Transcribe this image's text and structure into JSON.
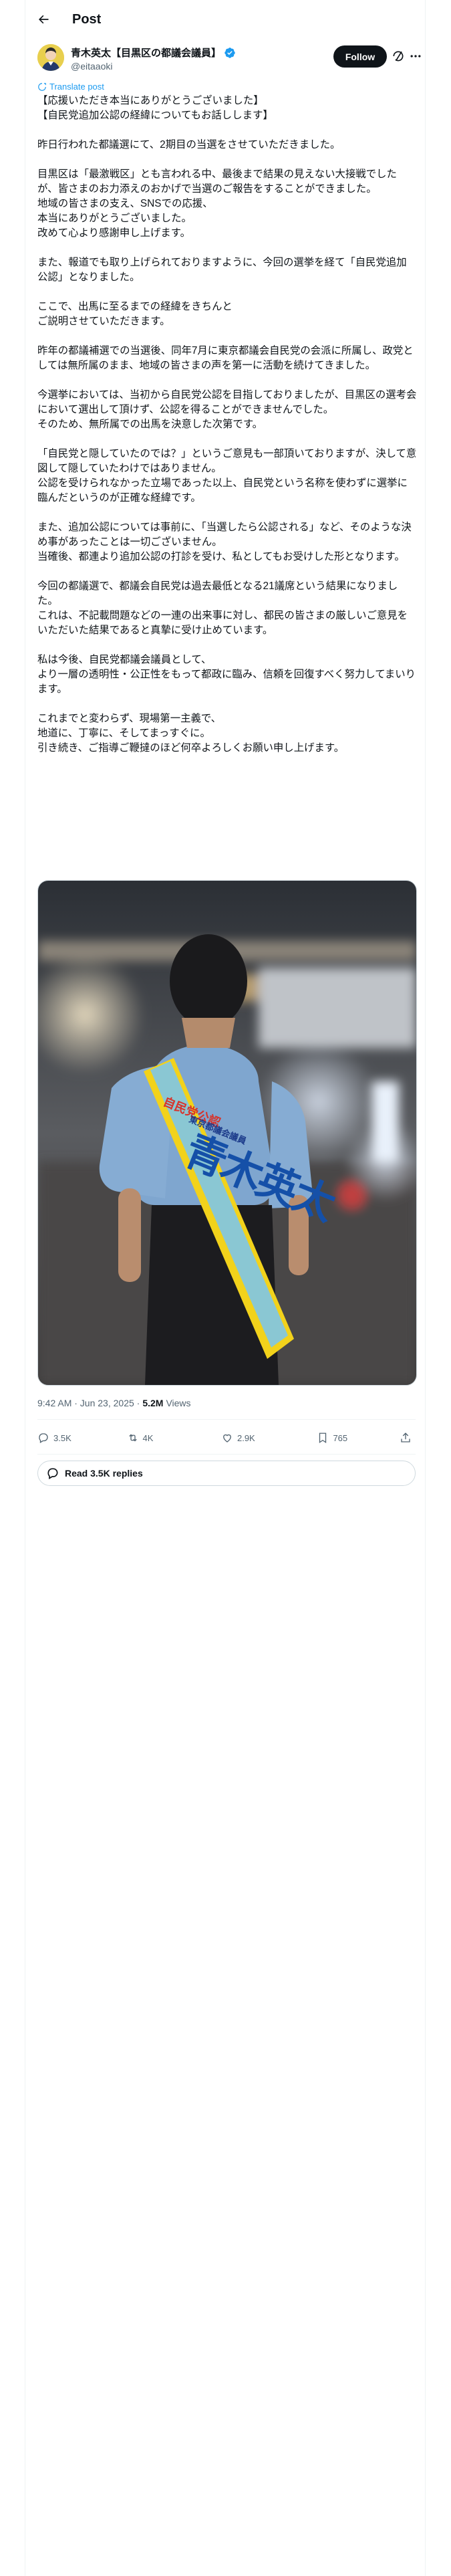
{
  "header": {
    "back_label": "←",
    "title": "Post"
  },
  "author": {
    "name": "青木英太【目黒区の都議会議員】",
    "handle": "@eitaaoki",
    "follow_label": "Follow"
  },
  "translate_label": "Translate post",
  "post_paragraphs": [
    [
      "【応援いただき本当にありがとうございました】",
      "【自民党追加公認の経緯についてもお話しします】"
    ],
    [
      "昨日行われた都議選にて、2期目の当選をさせていただきました。"
    ],
    [
      "目黒区は「最激戦区」とも言われる中、最後まで結果の見えない大接戦でしたが、皆さまのお力添えのおかげで当選のご報告をすることができました。",
      "地域の皆さまの支え、SNSでの応援、",
      "本当にありがとうございました。",
      "改めて心より感謝申し上げます。"
    ],
    [
      "また、報道でも取り上げられておりますように、今回の選挙を経て「自民党追加公認」となりました。"
    ],
    [
      "ここで、出馬に至るまでの経緯をきちんと",
      "ご説明させていただきます。"
    ],
    [
      "昨年の都議補選での当選後、同年7月に東京都議会自民党の会派に所属し、政党としては無所属のまま、地域の皆さまの声を第一に活動を続けてきました。"
    ],
    [
      "今選挙においては、当初から自民党公認を目指しておりましたが、目黒区の選考会において選出して頂けず、公認を得ることができませんでした。",
      "そのため、無所属での出馬を決意した次第です。"
    ],
    [
      "「自民党と隠していたのでは？」というご意見も一部頂いておりますが、決して意図して隠していたわけではありません。",
      "公認を受けられなかった立場であった以上、自民党という名称を使わずに選挙に臨んだというのが正確な経緯です。"
    ],
    [
      "また、追加公認については事前に、「当選したら公認される」など、そのような決め事があったことは一切ございません。",
      "当確後、都連より追加公認の打診を受け、私としてもお受けした形となります。"
    ],
    [
      "今回の都議選で、都議会自民党は過去最低となる21議席という結果になりました。",
      "これは、不記載問題などの一連の出来事に対し、都民の皆さまの厳しいご意見をいただいた結果であると真摯に受け止めています。"
    ],
    [
      "私は今後、自民党都議会議員として、",
      "より一層の透明性・公正性をもって都政に臨み、信頼を回復すべく努力してまいります。"
    ],
    [
      "これまでと変わらず、現場第一主義で、",
      "地道に、丁寧に、そしてまっすぐに。",
      "引き続き、ご指導ご鞭撻のほど何卒よろしくお願い申し上げます。"
    ]
  ],
  "photo": {
    "sash_line1": "自民党公認",
    "sash_line2": "東京都議会議員",
    "sash_name": "青木英太"
  },
  "meta": {
    "time": "9:42 AM · Jun 23, 2025 ·",
    "views_count": "5.2M",
    "views_label": "Views"
  },
  "actions": {
    "replies": "3.5K",
    "reposts": "4K",
    "likes": "2.9K",
    "bookmarks": "765"
  },
  "read_replies_label": "Read 3.5K replies",
  "colors": {
    "accent": "#1d9bf0",
    "text": "#0f1419",
    "muted": "#536471",
    "sash": "#f2d21b"
  }
}
